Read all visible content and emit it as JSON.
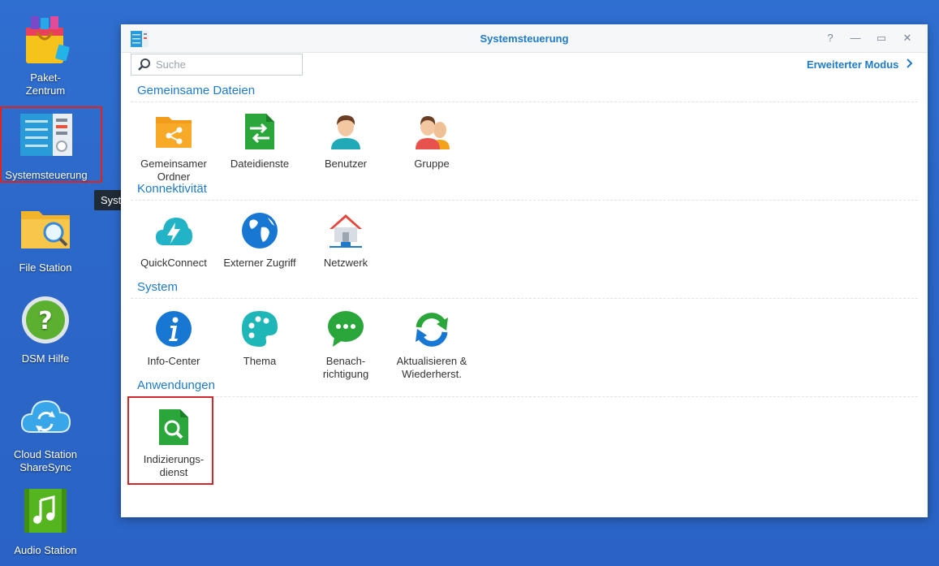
{
  "desktop": {
    "icons": [
      {
        "label": "Paket-\nZentrum"
      },
      {
        "label": "Systemsteuerung"
      },
      {
        "label": "File Station"
      },
      {
        "label": "DSM Hilfe"
      },
      {
        "label": "Cloud Station\nShareSync"
      },
      {
        "label": "Audio Station"
      }
    ],
    "tooltip": "Systemsteuerung"
  },
  "window": {
    "title": "Systemsteuerung",
    "search_placeholder": "Suche",
    "advanced_mode": "Erweiterter Modus",
    "controls": {
      "help": "?",
      "minimize": "—",
      "maximize": "▭",
      "close": "✕"
    }
  },
  "sections": [
    {
      "title": "Gemeinsame Dateien",
      "items": [
        {
          "label": "Gemeinsamer\nOrdner",
          "icon": "shared-folder-icon"
        },
        {
          "label": "Dateidienste",
          "icon": "file-services-icon"
        },
        {
          "label": "Benutzer",
          "icon": "user-icon"
        },
        {
          "label": "Gruppe",
          "icon": "group-icon"
        }
      ]
    },
    {
      "title": "Konnektivität",
      "items": [
        {
          "label": "QuickConnect",
          "icon": "quickconnect-icon"
        },
        {
          "label": "Externer Zugriff",
          "icon": "globe-icon"
        },
        {
          "label": "Netzwerk",
          "icon": "network-house-icon"
        }
      ]
    },
    {
      "title": "System",
      "items": [
        {
          "label": "Info-Center",
          "icon": "info-icon"
        },
        {
          "label": "Thema",
          "icon": "palette-icon"
        },
        {
          "label": "Benach-\nrichtigung",
          "icon": "chat-bubble-icon"
        },
        {
          "label": "Aktualisieren &\nWiederherst.",
          "icon": "refresh-icon"
        }
      ]
    },
    {
      "title": "Anwendungen",
      "items": [
        {
          "label": "Indizierungs-\ndienst",
          "icon": "indexing-search-icon"
        }
      ]
    }
  ],
  "colors": {
    "accent": "#1f7ac7",
    "highlight": "#d0252a",
    "desktop": "#2c68c9"
  }
}
